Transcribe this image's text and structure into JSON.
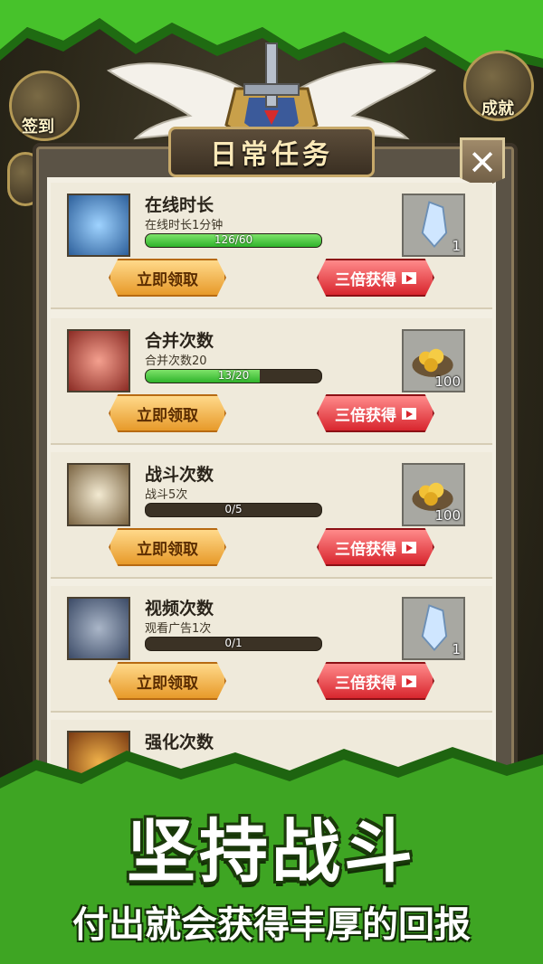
{
  "header": {
    "left_button_label": "签到",
    "right_button_label": "成就"
  },
  "dialog": {
    "title": "日常任务",
    "close_label": "✕"
  },
  "tasks": [
    {
      "name": "在线时长",
      "desc": "在线时长1分钟",
      "progress_text": "126/60",
      "progress": 1.0,
      "reward_count": "1",
      "reward_type": "crystal",
      "claim_label": "立即领取",
      "triple_label": "三倍获得"
    },
    {
      "name": "合并次数",
      "desc": "合并次数20",
      "progress_text": "13/20",
      "progress": 0.65,
      "reward_count": "100",
      "reward_type": "gold",
      "claim_label": "立即领取",
      "triple_label": "三倍获得"
    },
    {
      "name": "战斗次数",
      "desc": "战斗5次",
      "progress_text": "0/5",
      "progress": 0,
      "reward_count": "100",
      "reward_type": "gold",
      "claim_label": "立即领取",
      "triple_label": "三倍获得"
    },
    {
      "name": "视频次数",
      "desc": "观看广告1次",
      "progress_text": "0/1",
      "progress": 0,
      "reward_count": "1",
      "reward_type": "crystal",
      "claim_label": "立即领取",
      "triple_label": "三倍获得"
    },
    {
      "name": "强化次数"
    }
  ],
  "promo": {
    "headline": "坚持战斗",
    "subline": "付出就会获得丰厚的回报"
  },
  "colors": {
    "green_band": "#3db323",
    "claim_button": "#e79a2a",
    "triple_button": "#d8262e",
    "progress_fill": "#2fb32b"
  }
}
